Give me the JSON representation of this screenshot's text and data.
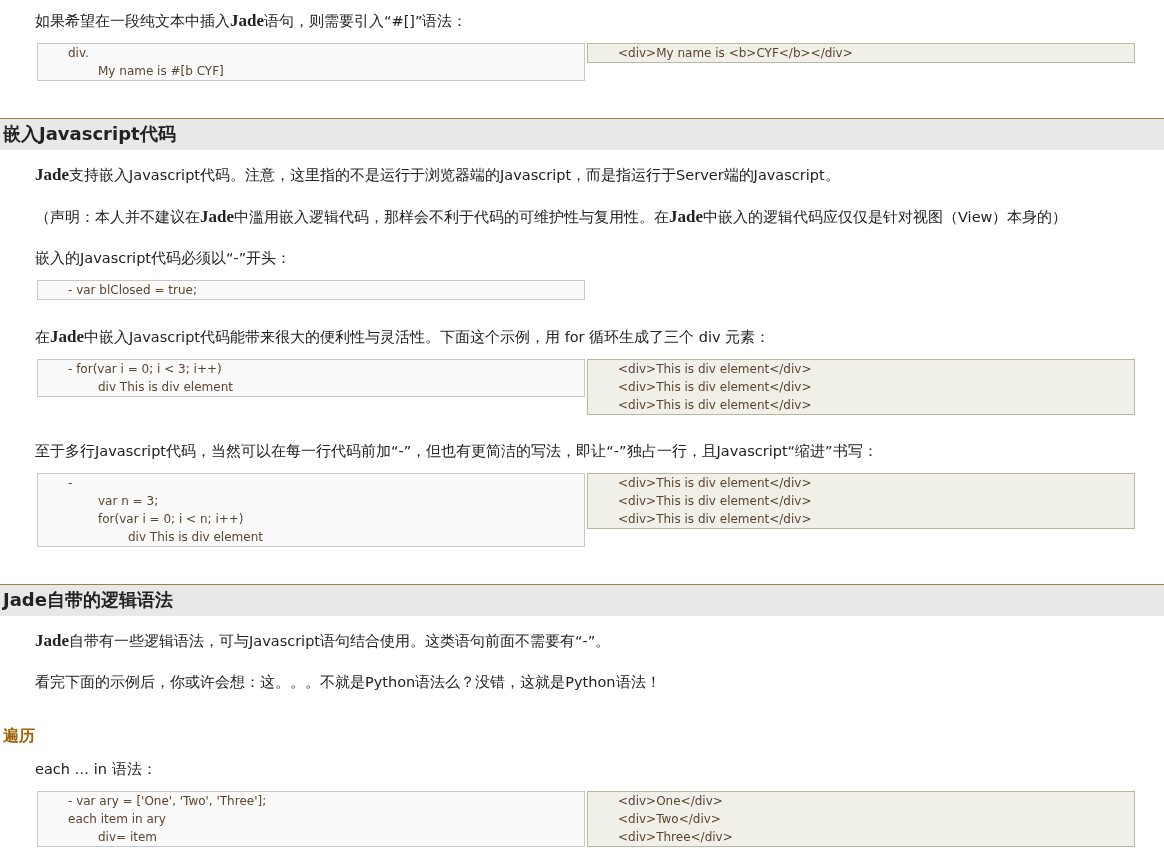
{
  "blocks": [
    {
      "kind": "paragraph",
      "text": "如果希望在一段纯文本中插入**Jade**语句，则需要引入“#[]”语法："
    },
    {
      "kind": "code_pair",
      "source": [
        {
          "text": "div.",
          "children": [
            {
              "text": "My name is #[b CYF]"
            }
          ]
        }
      ],
      "output": [
        {
          "text": "<div>My name is <b>CYF</b></div>"
        }
      ]
    },
    {
      "kind": "heading",
      "text": "嵌入Javascript代码"
    },
    {
      "kind": "paragraph",
      "text": "**Jade**支持嵌入Javascript代码。注意，这里指的不是运行于浏览器端的Javascript，而是指运行于Server端的Javascript。"
    },
    {
      "kind": "paragraph",
      "text": "（声明：本人并不建议在**Jade**中滥用嵌入逻辑代码，那样会不利于代码的可维护性与复用性。在**Jade**中嵌入的逻辑代码应仅仅是针对视图（View）本身的）"
    },
    {
      "kind": "paragraph",
      "text": "嵌入的Javascript代码必须以“-”开头："
    },
    {
      "kind": "code",
      "source": [
        {
          "text": "- var blClosed = true;"
        }
      ]
    },
    {
      "kind": "paragraph",
      "text": "在**Jade**中嵌入Javascript代码能带来很大的便利性与灵活性。下面这个示例，用 for 循环生成了三个 div 元素："
    },
    {
      "kind": "code_pair",
      "source": [
        {
          "text": "- for(var i = 0; i < 3; i++)",
          "children": [
            {
              "text": "div This is div element"
            }
          ]
        }
      ],
      "output": [
        {
          "text": "<div>This is div element</div>"
        },
        {
          "text": "<div>This is div element</div>"
        },
        {
          "text": "<div>This is div element</div>"
        }
      ]
    },
    {
      "kind": "paragraph",
      "text": "至于多行Javascript代码，当然可以在每一行代码前加“-”，但也有更简洁的写法，即让“-”独占一行，且Javascript“缩进”书写："
    },
    {
      "kind": "code_pair",
      "source": [
        {
          "text": "-",
          "children": [
            {
              "text": "var n = 3;"
            },
            {
              "text": "for(var i = 0; i < n; i++)",
              "children": [
                {
                  "text": "div This is div element"
                }
              ]
            }
          ]
        }
      ],
      "output": [
        {
          "text": "<div>This is div element</div>"
        },
        {
          "text": "<div>This is div element</div>"
        },
        {
          "text": "<div>This is div element</div>"
        }
      ]
    },
    {
      "kind": "heading",
      "text": "Jade自带的逻辑语法"
    },
    {
      "kind": "paragraph",
      "text": "**Jade**自带有一些逻辑语法，可与Javascript语句结合使用。这类语句前面不需要有“-”。"
    },
    {
      "kind": "paragraph",
      "text": "看完下面的示例后，你或许会想：这。。。不就是Python语法么？没错，这就是Python语法！"
    },
    {
      "kind": "subheading",
      "text": "遍历"
    },
    {
      "kind": "paragraph",
      "text": "each … in 语法："
    },
    {
      "kind": "code_pair",
      "source": [
        {
          "text": "- var ary = ['One', 'Two', 'Three'];"
        },
        {
          "text": "each item in ary",
          "children": [
            {
              "text": "div= item"
            }
          ]
        }
      ],
      "output": [
        {
          "text": "<div>One</div>"
        },
        {
          "text": "<div>Two</div>"
        },
        {
          "text": "<div>Three</div>"
        }
      ]
    }
  ]
}
